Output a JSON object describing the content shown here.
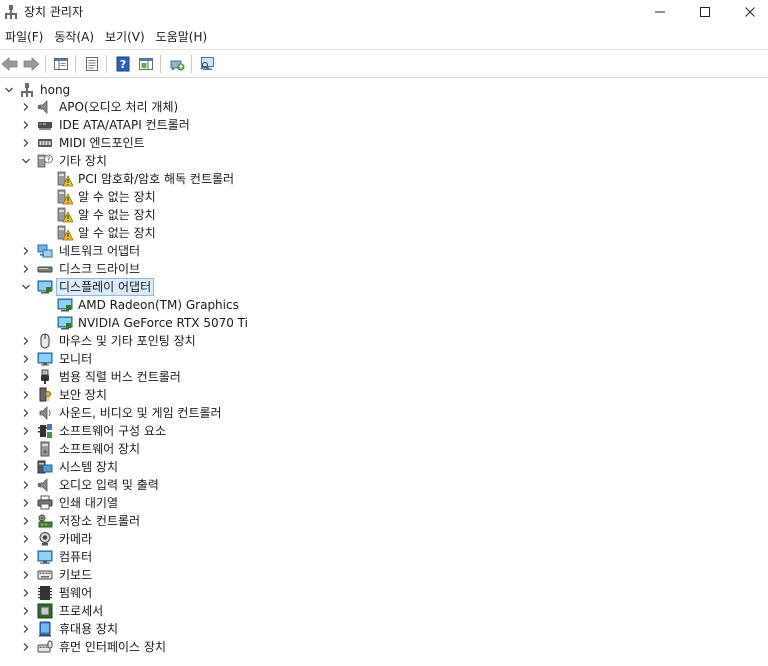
{
  "window": {
    "title": "장치 관리자",
    "app_icon": "device-manager-icon"
  },
  "menu": [
    "파일(F)",
    "동작(A)",
    "보기(V)",
    "도움말(H)"
  ],
  "toolbar": [
    "back-arrow-icon",
    "forward-arrow-icon",
    "show-hide-console-tree-icon",
    "properties-icon",
    "help-icon",
    "action-pane-icon",
    "update-driver-icon",
    "scan-hardware-changes-icon"
  ],
  "tree": {
    "root": "hong",
    "categories": [
      {
        "label": "APO(오디오 처리 개체)",
        "icon": "speaker-icon",
        "expanded": false,
        "children": []
      },
      {
        "label": "IDE ATA/ATAPI 컨트롤러",
        "icon": "ide-controller-icon",
        "expanded": false,
        "children": []
      },
      {
        "label": "MIDI 엔드포인트",
        "icon": "midi-keyboard-icon",
        "expanded": false,
        "children": []
      },
      {
        "label": "기타 장치",
        "icon": "unknown-device-icon",
        "expanded": true,
        "children": [
          {
            "label": "PCI 암호화/암호 해독 컨트롤러",
            "icon": "warning-device-icon"
          },
          {
            "label": "알 수 없는 장치",
            "icon": "warning-device-icon"
          },
          {
            "label": "알 수 없는 장치",
            "icon": "warning-device-icon"
          },
          {
            "label": "알 수 없는 장치",
            "icon": "warning-device-icon"
          }
        ]
      },
      {
        "label": "네트워크 어댑터",
        "icon": "network-adapter-icon",
        "expanded": false,
        "children": []
      },
      {
        "label": "디스크 드라이브",
        "icon": "disk-drive-icon",
        "expanded": false,
        "children": []
      },
      {
        "label": "디스플레이 어댑터",
        "icon": "display-adapter-icon",
        "expanded": true,
        "selected": true,
        "children": [
          {
            "label": "AMD Radeon(TM) Graphics",
            "icon": "display-adapter-icon"
          },
          {
            "label": "NVIDIA GeForce RTX 5070 Ti",
            "icon": "display-adapter-icon"
          }
        ]
      },
      {
        "label": "마우스 및 기타 포인팅 장치",
        "icon": "mouse-icon",
        "expanded": false,
        "children": []
      },
      {
        "label": "모니터",
        "icon": "monitor-icon",
        "expanded": false,
        "children": []
      },
      {
        "label": "범용 직렬 버스 컨트롤러",
        "icon": "usb-icon",
        "expanded": false,
        "children": []
      },
      {
        "label": "보안 장치",
        "icon": "security-key-icon",
        "expanded": false,
        "children": []
      },
      {
        "label": "사운드, 비디오 및 게임 컨트롤러",
        "icon": "sound-icon",
        "expanded": false,
        "children": []
      },
      {
        "label": "소프트웨어 구성 요소",
        "icon": "software-component-icon",
        "expanded": false,
        "children": []
      },
      {
        "label": "소프트웨어 장치",
        "icon": "software-device-icon",
        "expanded": false,
        "children": []
      },
      {
        "label": "시스템 장치",
        "icon": "system-device-icon",
        "expanded": false,
        "children": []
      },
      {
        "label": "오디오 입력 및 출력",
        "icon": "speaker-icon",
        "expanded": false,
        "children": []
      },
      {
        "label": "인쇄 대기열",
        "icon": "printer-icon",
        "expanded": false,
        "children": []
      },
      {
        "label": "저장소 컨트롤러",
        "icon": "storage-controller-icon",
        "expanded": false,
        "children": []
      },
      {
        "label": "카메라",
        "icon": "camera-icon",
        "expanded": false,
        "children": []
      },
      {
        "label": "컴퓨터",
        "icon": "computer-icon",
        "expanded": false,
        "children": []
      },
      {
        "label": "키보드",
        "icon": "keyboard-icon",
        "expanded": false,
        "children": []
      },
      {
        "label": "펌웨어",
        "icon": "firmware-icon",
        "expanded": false,
        "children": []
      },
      {
        "label": "프로세서",
        "icon": "processor-icon",
        "expanded": false,
        "children": []
      },
      {
        "label": "휴대용 장치",
        "icon": "portable-device-icon",
        "expanded": false,
        "children": []
      },
      {
        "label": "휴먼 인터페이스 장치",
        "icon": "human-interface-device-icon",
        "expanded": false,
        "children": []
      }
    ]
  }
}
